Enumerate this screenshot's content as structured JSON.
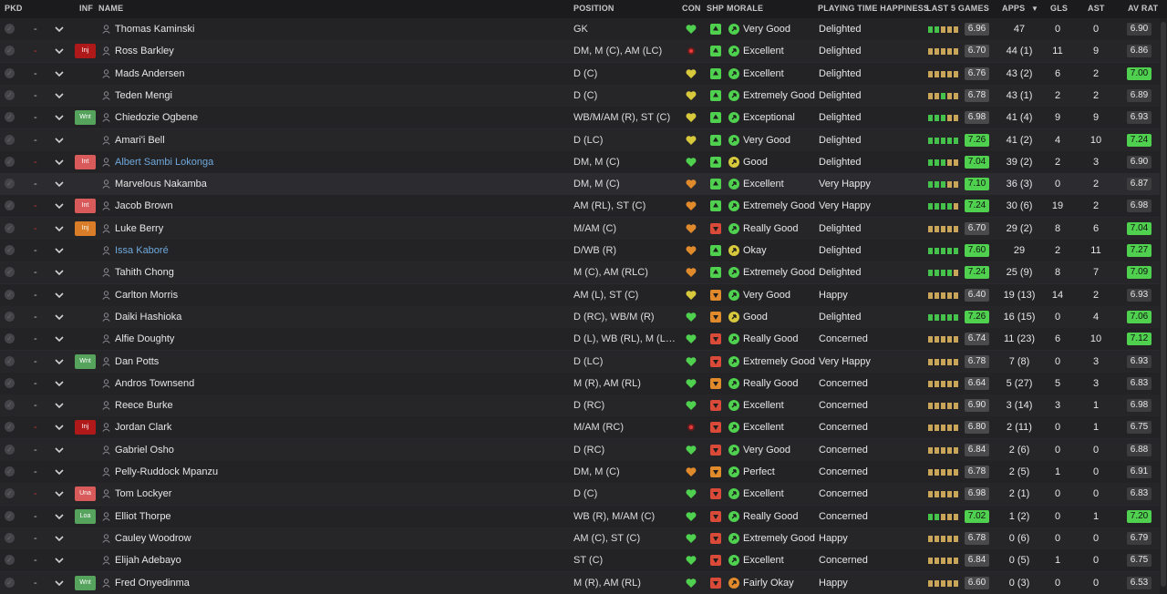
{
  "headers": {
    "pkd": "PKD",
    "inf": "INF",
    "name": "NAME",
    "position": "POSITION",
    "con": "CON",
    "shp": "SHP",
    "morale": "MORALE",
    "pth": "PLAYING TIME HAPPINESS",
    "last5": "LAST 5 GAMES",
    "apps": "APPS",
    "gls": "GLS",
    "ast": "AST",
    "avrat": "AV RAT"
  },
  "colors": {
    "green": "#4fd04f",
    "yellow": "#d8c93c",
    "orange": "#e08a2c",
    "red": "#d94a38",
    "formGood": "#44c24b",
    "formAvg": "#c9a55a"
  },
  "players": [
    {
      "pkd_dash": "-",
      "inf": "",
      "name": "Thomas Kaminski",
      "position": "GK",
      "con": "green",
      "shp": "green",
      "morale_icon": "green",
      "morale": "Very Good",
      "pth": "Delighted",
      "form": [
        "g",
        "g",
        "a",
        "a",
        "a"
      ],
      "rating": "6.96",
      "apps": "47",
      "gls": "0",
      "ast": "0",
      "avrat": "6.90"
    },
    {
      "pkd_dash": "-",
      "inf": "Inj",
      "name": "Ross Barkley",
      "position": "DM, M (C), AM (LC)",
      "con": "injured",
      "shp": "green",
      "morale_icon": "green",
      "morale": "Excellent",
      "pth": "Delighted",
      "form": [
        "a",
        "a",
        "a",
        "a",
        "a"
      ],
      "rating": "6.70",
      "apps": "44 (1)",
      "gls": "11",
      "ast": "9",
      "avrat": "6.86"
    },
    {
      "pkd_dash": "-",
      "inf": "",
      "name": "Mads Andersen",
      "position": "D (C)",
      "con": "yellow",
      "shp": "green",
      "morale_icon": "green",
      "morale": "Excellent",
      "pth": "Delighted",
      "form": [
        "a",
        "a",
        "a",
        "a",
        "a"
      ],
      "rating": "6.76",
      "apps": "43 (2)",
      "gls": "6",
      "ast": "2",
      "avrat": "7.00"
    },
    {
      "pkd_dash": "-",
      "inf": "",
      "name": "Teden Mengi",
      "position": "D (C)",
      "con": "yellow",
      "shp": "green",
      "morale_icon": "green",
      "morale": "Extremely Good",
      "pth": "Delighted",
      "form": [
        "a",
        "a",
        "g",
        "a",
        "a"
      ],
      "rating": "6.78",
      "apps": "43 (1)",
      "gls": "2",
      "ast": "2",
      "avrat": "6.89"
    },
    {
      "pkd_dash": "-",
      "inf": "Wnt",
      "name": "Chiedozie Ogbene",
      "position": "WB/M/AM (R), ST (C)",
      "con": "yellow",
      "shp": "green",
      "morale_icon": "green",
      "morale": "Exceptional",
      "pth": "Delighted",
      "form": [
        "g",
        "g",
        "g",
        "a",
        "a"
      ],
      "rating": "6.98",
      "apps": "41 (4)",
      "gls": "9",
      "ast": "9",
      "avrat": "6.93"
    },
    {
      "pkd_dash": "-",
      "inf": "",
      "name": "Amari'i Bell",
      "position": "D (LC)",
      "con": "yellow",
      "shp": "green",
      "morale_icon": "green",
      "morale": "Very Good",
      "pth": "Delighted",
      "form": [
        "g",
        "g",
        "g",
        "g",
        "g"
      ],
      "rating": "7.26",
      "apps": "41 (2)",
      "gls": "4",
      "ast": "10",
      "avrat": "7.24"
    },
    {
      "pkd_dash": "-",
      "inf": "Int",
      "name": "Albert Sambi Lokonga",
      "position": "DM, M (C)",
      "con": "green",
      "shp": "green",
      "morale_icon": "yellow",
      "morale": "Good",
      "pth": "Delighted",
      "form": [
        "g",
        "g",
        "g",
        "a",
        "a"
      ],
      "rating": "7.04",
      "apps": "39 (2)",
      "gls": "2",
      "ast": "3",
      "avrat": "6.90"
    },
    {
      "pkd_dash": "-",
      "inf": "",
      "name": "Marvelous Nakamba",
      "position": "DM, M (C)",
      "con": "orange",
      "shp": "green",
      "morale_icon": "green",
      "morale": "Excellent",
      "pth": "Very Happy",
      "form": [
        "g",
        "g",
        "g",
        "a",
        "a"
      ],
      "rating": "7.10",
      "apps": "36 (3)",
      "gls": "0",
      "ast": "2",
      "avrat": "6.87"
    },
    {
      "pkd_dash": "-",
      "inf": "Int",
      "name": "Jacob Brown",
      "position": "AM (RL), ST (C)",
      "con": "orange",
      "shp": "green",
      "morale_icon": "green",
      "morale": "Extremely Good",
      "pth": "Very Happy",
      "form": [
        "g",
        "g",
        "g",
        "g",
        "a"
      ],
      "rating": "7.24",
      "apps": "30 (6)",
      "gls": "19",
      "ast": "2",
      "avrat": "6.98"
    },
    {
      "pkd_dash": "-",
      "inf": "Inj",
      "name": "Luke Berry",
      "position": "M/AM (C)",
      "con": "orange",
      "shp": "red",
      "morale_icon": "green",
      "morale": "Really Good",
      "pth": "Delighted",
      "form": [
        "a",
        "a",
        "a",
        "a",
        "a"
      ],
      "rating": "6.70",
      "apps": "29 (2)",
      "gls": "8",
      "ast": "6",
      "avrat": "7.04"
    },
    {
      "pkd_dash": "-",
      "inf": "",
      "name": "Issa Kaboré",
      "position": "D/WB (R)",
      "con": "orange",
      "shp": "green",
      "morale_icon": "yellow",
      "morale": "Okay",
      "pth": "Delighted",
      "form": [
        "g",
        "g",
        "g",
        "g",
        "g"
      ],
      "rating": "7.60",
      "apps": "29",
      "gls": "2",
      "ast": "11",
      "avrat": "7.27"
    },
    {
      "pkd_dash": "-",
      "inf": "",
      "name": "Tahith Chong",
      "position": "M (C), AM (RLC)",
      "con": "orange",
      "shp": "green",
      "morale_icon": "green",
      "morale": "Extremely Good",
      "pth": "Delighted",
      "form": [
        "g",
        "g",
        "g",
        "g",
        "a"
      ],
      "rating": "7.24",
      "apps": "25 (9)",
      "gls": "8",
      "ast": "7",
      "avrat": "7.09"
    },
    {
      "pkd_dash": "-",
      "inf": "",
      "name": "Carlton Morris",
      "position": "AM (L), ST (C)",
      "con": "yellow",
      "shp": "orange",
      "morale_icon": "green",
      "morale": "Very Good",
      "pth": "Happy",
      "form": [
        "a",
        "a",
        "a",
        "a",
        "a"
      ],
      "rating": "6.40",
      "apps": "19 (13)",
      "gls": "14",
      "ast": "2",
      "avrat": "6.93"
    },
    {
      "pkd_dash": "-",
      "inf": "",
      "name": "Daiki Hashioka",
      "position": "D (RC), WB/M (R)",
      "con": "green",
      "shp": "orange",
      "morale_icon": "yellow",
      "morale": "Good",
      "pth": "Delighted",
      "form": [
        "g",
        "g",
        "g",
        "g",
        "g"
      ],
      "rating": "7.26",
      "apps": "16 (15)",
      "gls": "0",
      "ast": "4",
      "avrat": "7.06"
    },
    {
      "pkd_dash": "-",
      "inf": "",
      "name": "Alfie Doughty",
      "position": "D (L), WB (RL), M (L),...",
      "con": "green",
      "shp": "red",
      "morale_icon": "green",
      "morale": "Really Good",
      "pth": "Concerned",
      "form": [
        "a",
        "a",
        "a",
        "a",
        "a"
      ],
      "rating": "6.74",
      "apps": "11 (23)",
      "gls": "6",
      "ast": "10",
      "avrat": "7.12"
    },
    {
      "pkd_dash": "-",
      "inf": "Wnt",
      "name": "Dan Potts",
      "position": "D (LC)",
      "con": "green",
      "shp": "red",
      "morale_icon": "green",
      "morale": "Extremely Good",
      "pth": "Very Happy",
      "form": [
        "a",
        "a",
        "a",
        "a",
        "a"
      ],
      "rating": "6.78",
      "apps": "7 (8)",
      "gls": "0",
      "ast": "3",
      "avrat": "6.93"
    },
    {
      "pkd_dash": "-",
      "inf": "",
      "name": "Andros Townsend",
      "position": "M (R), AM (RL)",
      "con": "green",
      "shp": "orange",
      "morale_icon": "green",
      "morale": "Really Good",
      "pth": "Concerned",
      "form": [
        "a",
        "a",
        "a",
        "a",
        "a"
      ],
      "rating": "6.64",
      "apps": "5 (27)",
      "gls": "5",
      "ast": "3",
      "avrat": "6.83"
    },
    {
      "pkd_dash": "-",
      "inf": "",
      "name": "Reece Burke",
      "position": "D (RC)",
      "con": "green",
      "shp": "red",
      "morale_icon": "green",
      "morale": "Excellent",
      "pth": "Concerned",
      "form": [
        "a",
        "a",
        "a",
        "a",
        "a"
      ],
      "rating": "6.90",
      "apps": "3 (14)",
      "gls": "3",
      "ast": "1",
      "avrat": "6.98"
    },
    {
      "pkd_dash": "-",
      "inf": "Inj",
      "name": "Jordan Clark",
      "position": "M/AM (RC)",
      "con": "injured",
      "shp": "red",
      "morale_icon": "green",
      "morale": "Excellent",
      "pth": "Concerned",
      "form": [
        "a",
        "a",
        "a",
        "a",
        "a"
      ],
      "rating": "6.80",
      "apps": "2 (11)",
      "gls": "0",
      "ast": "1",
      "avrat": "6.75"
    },
    {
      "pkd_dash": "-",
      "inf": "",
      "name": "Gabriel Osho",
      "position": "D (RC)",
      "con": "green",
      "shp": "red",
      "morale_icon": "green",
      "morale": "Very Good",
      "pth": "Concerned",
      "form": [
        "a",
        "a",
        "a",
        "a",
        "a"
      ],
      "rating": "6.84",
      "apps": "2 (6)",
      "gls": "0",
      "ast": "0",
      "avrat": "6.88"
    },
    {
      "pkd_dash": "-",
      "inf": "",
      "name": "Pelly-Ruddock Mpanzu",
      "position": "DM, M (C)",
      "con": "orange",
      "shp": "orange",
      "morale_icon": "green",
      "morale": "Perfect",
      "pth": "Concerned",
      "form": [
        "a",
        "a",
        "a",
        "a",
        "a"
      ],
      "rating": "6.78",
      "apps": "2 (5)",
      "gls": "1",
      "ast": "0",
      "avrat": "6.91"
    },
    {
      "pkd_dash": "-",
      "inf": "Una",
      "name": "Tom Lockyer",
      "position": "D (C)",
      "con": "green",
      "shp": "red",
      "morale_icon": "green",
      "morale": "Excellent",
      "pth": "Concerned",
      "form": [
        "a",
        "a",
        "a",
        "a",
        "a"
      ],
      "rating": "6.98",
      "apps": "2 (1)",
      "gls": "0",
      "ast": "0",
      "avrat": "6.83"
    },
    {
      "pkd_dash": "-",
      "inf": "Loa",
      "name": "Elliot Thorpe",
      "position": "WB (R), M/AM (C)",
      "con": "green",
      "shp": "red",
      "morale_icon": "green",
      "morale": "Really Good",
      "pth": "Concerned",
      "form": [
        "g",
        "g",
        "a",
        "a",
        "a"
      ],
      "rating": "7.02",
      "apps": "1 (2)",
      "gls": "0",
      "ast": "1",
      "avrat": "7.20"
    },
    {
      "pkd_dash": "-",
      "inf": "",
      "name": "Cauley Woodrow",
      "position": "AM (C), ST (C)",
      "con": "green",
      "shp": "red",
      "morale_icon": "green",
      "morale": "Extremely Good",
      "pth": "Happy",
      "form": [
        "a",
        "a",
        "a",
        "a",
        "a"
      ],
      "rating": "6.78",
      "apps": "0 (6)",
      "gls": "0",
      "ast": "0",
      "avrat": "6.79"
    },
    {
      "pkd_dash": "-",
      "inf": "",
      "name": "Elijah Adebayo",
      "position": "ST (C)",
      "con": "green",
      "shp": "red",
      "morale_icon": "green",
      "morale": "Excellent",
      "pth": "Concerned",
      "form": [
        "a",
        "a",
        "a",
        "a",
        "a"
      ],
      "rating": "6.84",
      "apps": "0 (5)",
      "gls": "1",
      "ast": "0",
      "avrat": "6.75"
    },
    {
      "pkd_dash": "-",
      "inf": "Wnt",
      "name": "Fred Onyedinma",
      "position": "M (R), AM (RL)",
      "con": "green",
      "shp": "red",
      "morale_icon": "orange",
      "morale": "Fairly Okay",
      "pth": "Happy",
      "form": [
        "a",
        "a",
        "a",
        "a",
        "a"
      ],
      "rating": "6.60",
      "apps": "0 (3)",
      "gls": "0",
      "ast": "0",
      "avrat": "6.53"
    }
  ]
}
